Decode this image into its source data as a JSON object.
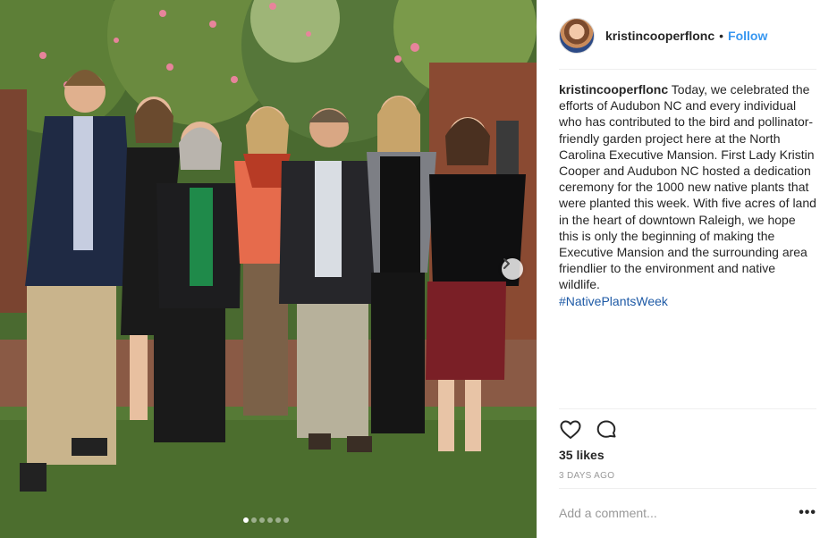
{
  "post": {
    "username": "kristincooperflonc",
    "separator": "•",
    "follow_label": "Follow",
    "caption_user": "kristincooperflonc",
    "caption_text": "Today, we celebrated the efforts of Audubon NC and every individual who has contributed to the bird and pollinator-friendly garden project here at the North Carolina Executive Mansion. First Lady Kristin Cooper and Audubon NC hosted a dedication ceremony for the 1000 new native plants that were planted this week. With five acres of land in the heart of downtown Raleigh, we hope this is only the beginning of making the Executive Mansion and the surrounding area friendlier to the environment and native wildlife.",
    "hashtag": "#NativePlantsWeek",
    "likes": "35 likes",
    "timestamp": "3 DAYS AGO",
    "comment_placeholder": "Add a comment...",
    "more_label": "•••"
  },
  "carousel": {
    "total_slides": 6,
    "active_slide": 1,
    "next_icon": "chevron-right-icon"
  },
  "icons": {
    "like": "heart-outline-icon",
    "comment": "speech-bubble-icon",
    "avatar": "profile-avatar"
  },
  "colors": {
    "link_blue": "#3897f0",
    "hashtag": "#1e5aa6",
    "text": "#262626",
    "muted": "#999999"
  }
}
